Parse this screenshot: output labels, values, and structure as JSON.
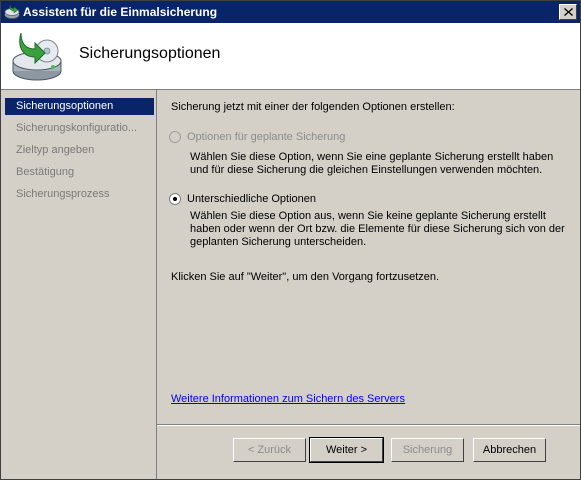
{
  "window": {
    "title": "Assistent für die Einmalsicherung",
    "close_glyph": "✕"
  },
  "header": {
    "title": "Sicherungsoptionen",
    "icon": "backup-drive-icon"
  },
  "sidebar": {
    "items": [
      {
        "label": "Sicherungsoptionen",
        "active": true
      },
      {
        "label": "Sicherungskonfiguratio..."
      },
      {
        "label": "Zieltyp angeben"
      },
      {
        "label": "Bestätigung"
      },
      {
        "label": "Sicherungsprozess"
      }
    ]
  },
  "main": {
    "intro": "Sicherung jetzt mit einer der folgenden Optionen erstellen:",
    "option1": {
      "label": "Optionen für geplante Sicherung",
      "desc_line1": "Wählen Sie diese Option, wenn Sie eine geplante Sicherung erstellt haben",
      "desc_line2": "und für diese Sicherung die gleichen Einstellungen verwenden möchten.",
      "enabled": false,
      "selected": false
    },
    "option2": {
      "label": "Unterschiedliche Optionen",
      "desc_line1": "Wählen Sie diese Option aus, wenn Sie keine geplante Sicherung erstellt",
      "desc_line2": "haben oder wenn der Ort bzw. die Elemente für diese Sicherung sich von der",
      "desc_line3": "geplanten Sicherung unterscheiden.",
      "enabled": true,
      "selected": true
    },
    "continue_text": "Klicken Sie auf \"Weiter\", um den Vorgang fortzusetzen.",
    "more_info_link": "Weitere Informationen zum Sichern des Servers"
  },
  "buttons": {
    "back": "< Zurück",
    "next": "Weiter >",
    "backup": "Sicherung",
    "cancel": "Abbrechen"
  },
  "colors": {
    "titlebar": "#0a246a",
    "selection": "#0a246a",
    "face": "#d4d0c8",
    "link": "#0000ff"
  }
}
